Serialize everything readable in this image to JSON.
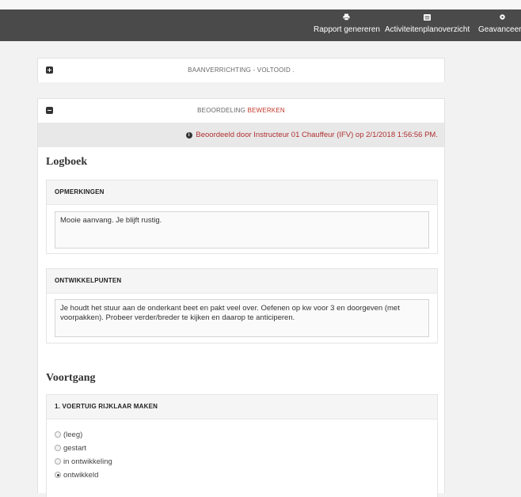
{
  "navbar": {
    "items": [
      {
        "icon": "print-icon",
        "label": "Rapport genereren"
      },
      {
        "icon": "list-icon",
        "label": "Activiteitenplanoverzicht"
      },
      {
        "icon": "gear-icon",
        "label": "Geavanceerd"
      }
    ]
  },
  "panel_baan": {
    "title": "BAANVERRICHTING - VOLTOOID ."
  },
  "panel_beoordeling": {
    "title_prefix": "BEOORDELING",
    "title_link": "BEWERKEN",
    "notice": "Beoordeeld door Instructeur 01 Chauffeur (IFV) op 2/1/2018 1:56:56 PM.",
    "logboek": {
      "heading": "Logboek",
      "opmerkingen": {
        "header": "OPMERKINGEN",
        "value": "Mooie aanvang. Je blijft rustig."
      },
      "ontwikkelpunten": {
        "header": "ONTWIKKELPUNTEN",
        "value": "Je houdt het stuur aan de onderkant beet en pakt veel over. Oefenen op kw voor 3 en doorgeven (met voorpakken). Probeer verder/breder te kijken en daarop te anticiperen."
      }
    },
    "voortgang": {
      "heading": "Voortgang",
      "item1": {
        "header": "1. VOERTUIG RIJKLAAR MAKEN",
        "options": [
          "(leeg)",
          "gestart",
          "in ontwikkeling",
          "ontwikkeld"
        ],
        "selected": "ontwikkeld"
      }
    }
  }
}
